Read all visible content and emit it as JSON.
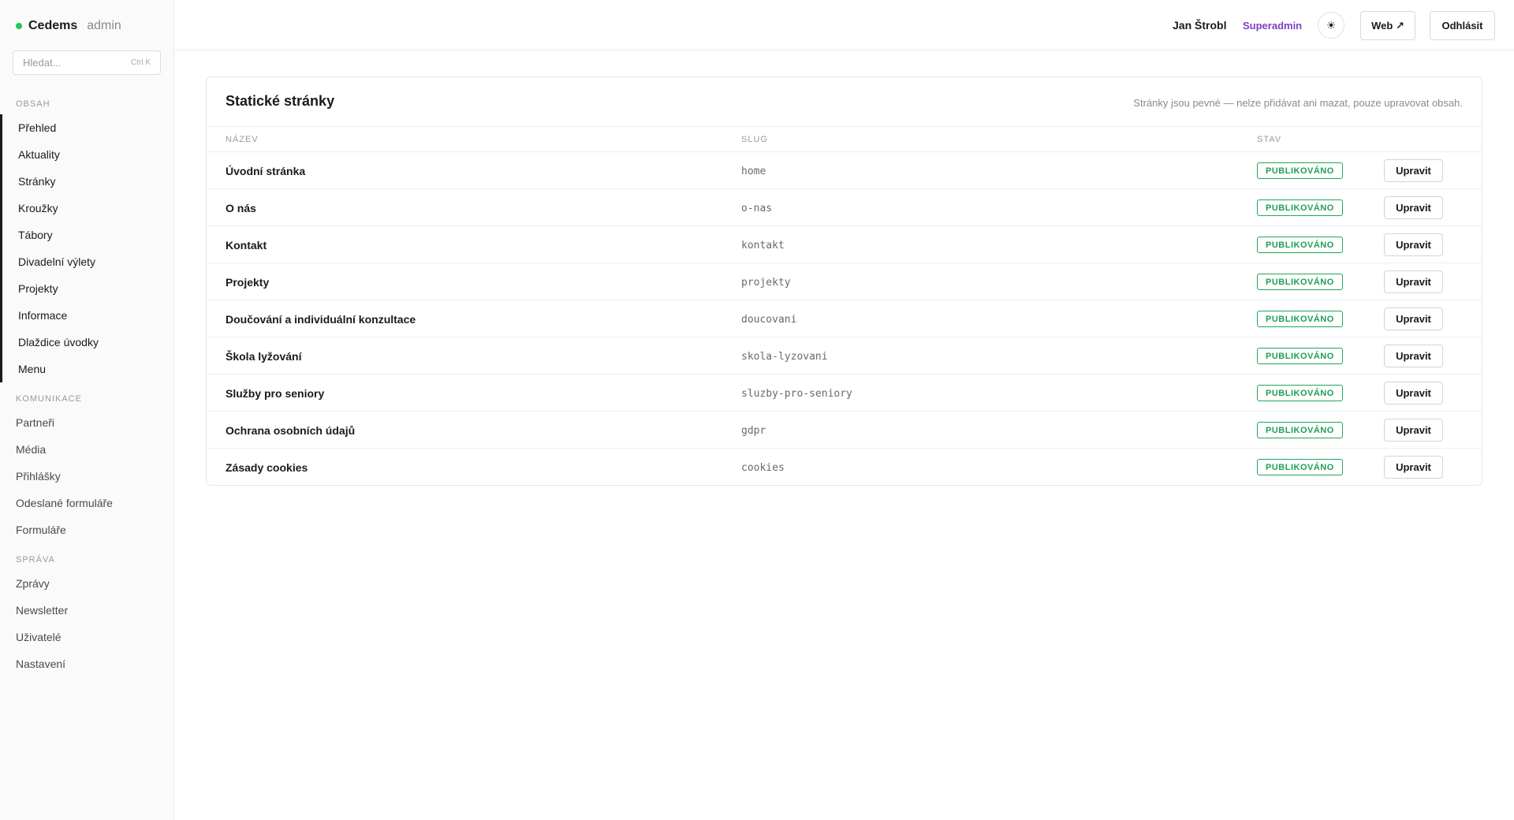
{
  "brand": {
    "name": "Cedems",
    "sub": "admin",
    "status_color": "#22c55e"
  },
  "search": {
    "placeholder": "Hledat...",
    "shortcut": "Ctrl K"
  },
  "sidebar": {
    "sections": [
      {
        "label": "OBSAH",
        "items": [
          "Přehled",
          "Aktuality",
          "Stránky",
          "Kroužky",
          "Tábory",
          "Divadelní výlety",
          "Projekty",
          "Informace",
          "Dlaždice úvodky",
          "Menu"
        ]
      },
      {
        "label": "KOMUNIKACE",
        "items": [
          "Partneři",
          "Média",
          "Přihlášky",
          "Odeslané formuláře",
          "Formuláře"
        ]
      },
      {
        "label": "SPRÁVA",
        "items": [
          "Zprávy",
          "Newsletter",
          "Uživatelé",
          "Nastavení"
        ]
      }
    ]
  },
  "topbar": {
    "user_name": "Jan Štrobl",
    "role": "Superadmin",
    "role_color": "#7e3fc4",
    "theme_icon": "☀",
    "web_label": "Web ↗",
    "logout_label": "Odhlásit"
  },
  "panel": {
    "title": "Statické stránky",
    "note": "Stránky jsou pevné — nelze přidávat ani mazat, pouze upravovat obsah.",
    "columns": {
      "name": "NÁZEV",
      "slug": "SLUG",
      "status": "STAV"
    },
    "edit_label": "Upravit",
    "rows": [
      {
        "name": "Úvodní stránka",
        "slug": "home",
        "status": "PUBLIKOVÁNO"
      },
      {
        "name": "O nás",
        "slug": "o-nas",
        "status": "PUBLIKOVÁNO"
      },
      {
        "name": "Kontakt",
        "slug": "kontakt",
        "status": "PUBLIKOVÁNO"
      },
      {
        "name": "Projekty",
        "slug": "projekty",
        "status": "PUBLIKOVÁNO"
      },
      {
        "name": "Doučování a individuální konzultace",
        "slug": "doucovani",
        "status": "PUBLIKOVÁNO"
      },
      {
        "name": "Škola lyžování",
        "slug": "skola-lyzovani",
        "status": "PUBLIKOVÁNO"
      },
      {
        "name": "Služby pro seniory",
        "slug": "sluzby-pro-seniory",
        "status": "PUBLIKOVÁNO"
      },
      {
        "name": "Ochrana osobních údajů",
        "slug": "gdpr",
        "status": "PUBLIKOVÁNO"
      },
      {
        "name": "Zásady cookies",
        "slug": "cookies",
        "status": "PUBLIKOVÁNO"
      }
    ]
  }
}
